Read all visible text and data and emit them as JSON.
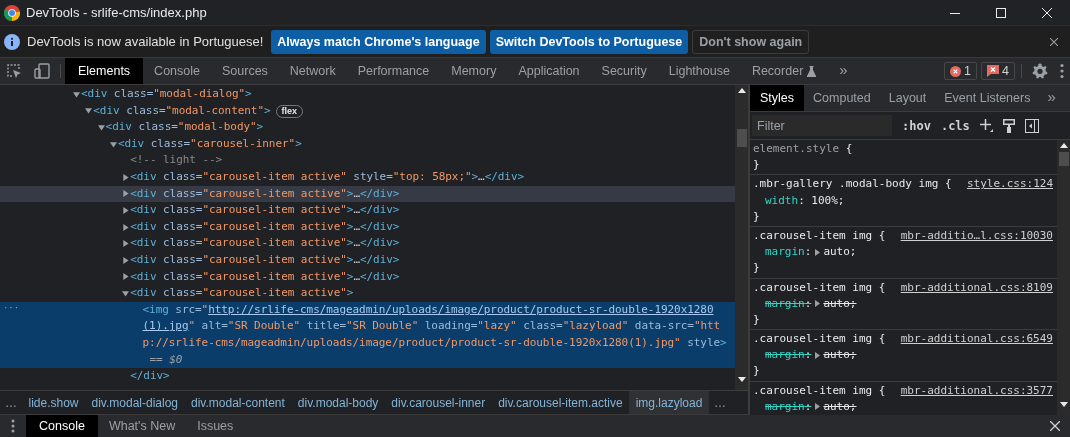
{
  "window": {
    "title": "DevTools - srlife-cms/index.php"
  },
  "infobar": {
    "message": "DevTools is now available in Portuguese!",
    "buttons": [
      {
        "label": "Always match Chrome's language",
        "kind": "primary"
      },
      {
        "label": "Switch DevTools to Portuguese",
        "kind": "primary"
      },
      {
        "label": "Don't show again",
        "kind": "secondary"
      }
    ]
  },
  "toolbar": {
    "tabs": [
      {
        "label": "Elements",
        "selected": true,
        "experimental": false
      },
      {
        "label": "Console",
        "selected": false,
        "experimental": false
      },
      {
        "label": "Sources",
        "selected": false,
        "experimental": false
      },
      {
        "label": "Network",
        "selected": false,
        "experimental": false
      },
      {
        "label": "Performance",
        "selected": false,
        "experimental": false
      },
      {
        "label": "Memory",
        "selected": false,
        "experimental": false
      },
      {
        "label": "Application",
        "selected": false,
        "experimental": false
      },
      {
        "label": "Security",
        "selected": false,
        "experimental": false
      },
      {
        "label": "Lighthouse",
        "selected": false,
        "experimental": false
      },
      {
        "label": "Recorder",
        "selected": false,
        "experimental": true
      }
    ],
    "more": "»",
    "errors": "1",
    "issues": "4"
  },
  "dom_tree": [
    {
      "kind": "element",
      "expanded": true,
      "selected": false,
      "hovered": false,
      "open": "<div",
      "attrs": [
        {
          "name": " class=",
          "value": "\"modal-dialog\""
        }
      ],
      "end": ">",
      "children": [
        {
          "kind": "element",
          "expanded": true,
          "selected": false,
          "hovered": false,
          "open": "<div",
          "attrs": [
            {
              "name": " class=",
              "value": "\"modal-content\""
            }
          ],
          "end": ">",
          "badge": "flex",
          "children": [
            {
              "kind": "element",
              "expanded": true,
              "selected": false,
              "hovered": false,
              "open": "<div",
              "attrs": [
                {
                  "name": " class=",
                  "value": "\"modal-body\""
                }
              ],
              "end": ">",
              "children": [
                {
                  "kind": "element",
                  "expanded": true,
                  "selected": false,
                  "hovered": false,
                  "open": "<div",
                  "attrs": [
                    {
                      "name": " class=",
                      "value": "\"carousel-inner\""
                    }
                  ],
                  "end": ">",
                  "children": [
                    {
                      "kind": "comment",
                      "selected": false,
                      "hovered": false,
                      "text": "<!-- light -->"
                    },
                    {
                      "kind": "element",
                      "expanded": false,
                      "selected": false,
                      "hovered": false,
                      "open": "<div",
                      "attrs": [
                        {
                          "name": " class=",
                          "value": "\"carousel-item active\""
                        },
                        {
                          "name": " style=",
                          "value": "\"top: 58px;\""
                        }
                      ],
                      "end": ">",
                      "ellipsis": "…",
                      "close": "</div>"
                    },
                    {
                      "kind": "element",
                      "expanded": false,
                      "selected": false,
                      "hovered": true,
                      "open": "<div",
                      "attrs": [
                        {
                          "name": " class=",
                          "value": "\"carousel-item active\""
                        }
                      ],
                      "end": ">",
                      "ellipsis": "…",
                      "close": "</div>"
                    },
                    {
                      "kind": "element",
                      "expanded": false,
                      "selected": false,
                      "hovered": false,
                      "open": "<div",
                      "attrs": [
                        {
                          "name": " class=",
                          "value": "\"carousel-item active\""
                        }
                      ],
                      "end": ">",
                      "ellipsis": "…",
                      "close": "</div>"
                    },
                    {
                      "kind": "element",
                      "expanded": false,
                      "selected": false,
                      "hovered": false,
                      "open": "<div",
                      "attrs": [
                        {
                          "name": " class=",
                          "value": "\"carousel-item active\""
                        }
                      ],
                      "end": ">",
                      "ellipsis": "…",
                      "close": "</div>"
                    },
                    {
                      "kind": "element",
                      "expanded": false,
                      "selected": false,
                      "hovered": false,
                      "open": "<div",
                      "attrs": [
                        {
                          "name": " class=",
                          "value": "\"carousel-item active\""
                        }
                      ],
                      "end": ">",
                      "ellipsis": "…",
                      "close": "</div>"
                    },
                    {
                      "kind": "element",
                      "expanded": false,
                      "selected": false,
                      "hovered": false,
                      "open": "<div",
                      "attrs": [
                        {
                          "name": " class=",
                          "value": "\"carousel-item active\""
                        }
                      ],
                      "end": ">",
                      "ellipsis": "…",
                      "close": "</div>"
                    },
                    {
                      "kind": "element",
                      "expanded": false,
                      "selected": false,
                      "hovered": false,
                      "open": "<div",
                      "attrs": [
                        {
                          "name": " class=",
                          "value": "\"carousel-item active\""
                        }
                      ],
                      "end": ">",
                      "ellipsis": "…",
                      "close": "</div>"
                    },
                    {
                      "kind": "element",
                      "expanded": true,
                      "selected": false,
                      "hovered": false,
                      "open": "<div",
                      "attrs": [
                        {
                          "name": " class=",
                          "value": "\"carousel-item active\""
                        }
                      ],
                      "end": ">",
                      "closing": "</div>",
                      "children": [
                        {
                          "kind": "leaf",
                          "selected": true,
                          "hovered": false,
                          "gutter": "···",
                          "open": "<img",
                          "attrs": [
                            {
                              "name": " src=",
                              "quote_open": "\"",
                              "link": "http://srlife-cms/mageadmin/uploads/image/product/product-sr-double-1920x1280(1).jpg",
                              "quote_close": "\""
                            },
                            {
                              "name": " alt=",
                              "value": "\"SR Double\""
                            },
                            {
                              "name": " title=",
                              "value": "\"SR Double\""
                            },
                            {
                              "name": " loading=",
                              "value": "\"lazy\""
                            },
                            {
                              "name": " class=",
                              "value": "\"lazyload\""
                            },
                            {
                              "name": " data-src=",
                              "value": "\"http://srlife-cms/mageadmin/uploads/image/product/product-sr-double-1920x1280(1).jpg\""
                            },
                            {
                              "name": " style"
                            }
                          ],
                          "end": ">",
                          "marker": "== $0"
                        }
                      ]
                    }
                  ]
                }
              ]
            }
          ]
        }
      ]
    }
  ],
  "breadcrumbs": {
    "start": "…",
    "items": [
      {
        "label": "lide.show",
        "selected": false
      },
      {
        "label": "div.modal-dialog",
        "selected": false
      },
      {
        "label": "div.modal-content",
        "selected": false
      },
      {
        "label": "div.modal-body",
        "selected": false
      },
      {
        "label": "div.carousel-inner",
        "selected": false
      },
      {
        "label": "div.carousel-item.active",
        "selected": false
      },
      {
        "label": "img.lazyload",
        "selected": true
      }
    ],
    "end": "…"
  },
  "styles_pane": {
    "tabs": [
      {
        "label": "Styles",
        "selected": true
      },
      {
        "label": "Computed",
        "selected": false
      },
      {
        "label": "Layout",
        "selected": false
      },
      {
        "label": "Event Listeners",
        "selected": false
      }
    ],
    "more": "»",
    "filter": {
      "placeholder": "Filter"
    },
    "hov": ":hov",
    "cls": ".cls",
    "rules": [
      {
        "kind": "inline",
        "selector": "element.style",
        "open": " {",
        "close": "}"
      },
      {
        "kind": "matched",
        "selector": ".mbr-gallery .modal-body img",
        "open": " {",
        "source": "style.css:124",
        "declarations": [
          {
            "name": "width",
            "colon": ":",
            "value": " 100%;",
            "overridden": false,
            "expandable": false
          }
        ],
        "close": "}"
      },
      {
        "kind": "matched",
        "selector": ".carousel-item img",
        "open": " {",
        "source": "mbr-additio…l.css:10030",
        "declarations": [
          {
            "name": "margin",
            "colon": ":",
            "value": "auto;",
            "overridden": false,
            "expandable": true
          }
        ],
        "close": "}"
      },
      {
        "kind": "matched",
        "selector": ".carousel-item img",
        "open": " {",
        "source": "mbr-additional.css:8109",
        "declarations": [
          {
            "name": "margin",
            "colon": ":",
            "value": "auto;",
            "overridden": true,
            "expandable": true
          }
        ],
        "close": "}"
      },
      {
        "kind": "matched",
        "selector": ".carousel-item img",
        "open": " {",
        "source": "mbr-additional.css:6549",
        "declarations": [
          {
            "name": "margin",
            "colon": ":",
            "value": "auto;",
            "overridden": true,
            "expandable": true
          }
        ],
        "close": "}"
      },
      {
        "kind": "matched",
        "selector": ".carousel-item img",
        "open": " {",
        "source": "mbr-additional.css:3577",
        "declarations": [
          {
            "name": "margin",
            "colon": ":",
            "value": "auto;",
            "overridden": true,
            "expandable": true
          }
        ]
      }
    ]
  },
  "drawer": {
    "tabs": [
      {
        "label": "Console",
        "selected": true
      },
      {
        "label": "What's New",
        "selected": false
      },
      {
        "label": "Issues",
        "selected": false
      }
    ]
  }
}
